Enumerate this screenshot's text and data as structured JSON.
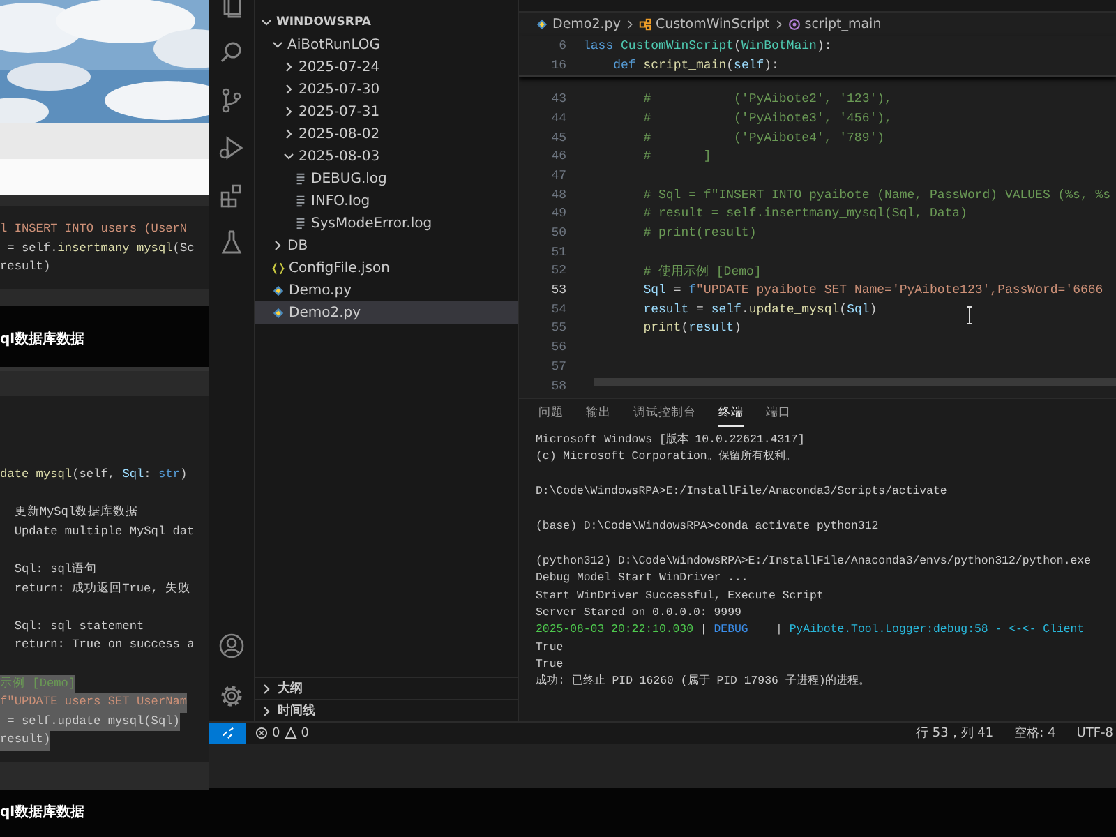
{
  "document": {
    "blocks": [
      {
        "kind": "picture"
      },
      {
        "kind": "bar"
      },
      {
        "kind": "code",
        "groups": [
          {
            "lines": [
              {
                "tokens": [
                  {
                    "text": "l INSERT INTO users (UserN",
                    "kind": "string"
                  }
                ]
              },
              {
                "tokens": [
                  {
                    "text": " = self.",
                    "kind": "plain"
                  },
                  {
                    "text": "insertmany_mysql",
                    "kind": "function"
                  },
                  {
                    "text": "(Sc",
                    "kind": "plain"
                  }
                ]
              },
              {
                "tokens": [
                  {
                    "text": "result)",
                    "kind": "plain"
                  }
                ]
              }
            ]
          }
        ]
      },
      {
        "kind": "heading",
        "text": "ql数据库数据"
      },
      {
        "kind": "code",
        "groups": [
          {
            "lines": [
              {
                "selected": false,
                "tokens": [
                  {
                    "text": "date_mysql",
                    "kind": "function"
                  },
                  {
                    "text": "(self, ",
                    "kind": "plain"
                  },
                  {
                    "text": "Sql",
                    "kind": "variable"
                  },
                  {
                    "text": ": ",
                    "kind": "plain"
                  },
                  {
                    "text": "str",
                    "kind": "keyword"
                  },
                  {
                    "text": ")",
                    "kind": "plain"
                  }
                ]
              }
            ]
          },
          {
            "lines": [
              {
                "selected": false,
                "tokens": [
                  {
                    "text": "  更新MySql数据库数据",
                    "kind": "plain"
                  }
                ]
              },
              {
                "selected": false,
                "tokens": [
                  {
                    "text": "  Update multiple MySql dat",
                    "kind": "plain"
                  }
                ]
              }
            ]
          },
          {
            "lines": [
              {
                "selected": false,
                "tokens": [
                  {
                    "text": "  Sql: sql语句",
                    "kind": "plain"
                  }
                ]
              },
              {
                "selected": false,
                "tokens": [
                  {
                    "text": "  return: 成功返回True, 失败",
                    "kind": "plain"
                  }
                ]
              }
            ]
          },
          {
            "lines": [
              {
                "selected": false,
                "tokens": [
                  {
                    "text": "  Sql: sql statement",
                    "kind": "plain"
                  }
                ]
              },
              {
                "selected": false,
                "tokens": [
                  {
                    "text": "  return: True on success a",
                    "kind": "plain"
                  }
                ]
              }
            ]
          },
          {
            "lines": [
              {
                "selected": true,
                "tokens": [
                  {
                    "text": "示例 [Demo]",
                    "kind": "comment"
                  }
                ]
              },
              {
                "selected": true,
                "tokens": [
                  {
                    "text": "f\"UPDATE users SET UserNam",
                    "kind": "string"
                  }
                ]
              },
              {
                "selected": true,
                "tokens": [
                  {
                    "text": " = self.update_mysql(Sql)",
                    "kind": "plain"
                  }
                ]
              },
              {
                "selected": true,
                "tokens": [
                  {
                    "text": "result)",
                    "kind": "plain"
                  }
                ]
              }
            ]
          }
        ]
      },
      {
        "kind": "heading",
        "text": "ql数据库数据"
      }
    ]
  },
  "explorer": {
    "tree": [
      {
        "label": "WINDOWSRPA",
        "kind": "root",
        "expanded": true,
        "selected": false,
        "children": [
          {
            "label": "AiBotRunLOG",
            "kind": "folder",
            "expanded": true,
            "selected": false,
            "children": [
              {
                "label": "2025-07-24",
                "kind": "folder",
                "expanded": false,
                "selected": false
              },
              {
                "label": "2025-07-30",
                "kind": "folder",
                "expanded": false,
                "selected": false
              },
              {
                "label": "2025-07-31",
                "kind": "folder",
                "expanded": false,
                "selected": false
              },
              {
                "label": "2025-08-02",
                "kind": "folder",
                "expanded": false,
                "selected": false
              },
              {
                "label": "2025-08-03",
                "kind": "folder",
                "expanded": true,
                "selected": false,
                "children": [
                  {
                    "label": "DEBUG.log",
                    "kind": "log",
                    "selected": false
                  },
                  {
                    "label": "INFO.log",
                    "kind": "log",
                    "selected": false
                  },
                  {
                    "label": "SysModeError.log",
                    "kind": "log",
                    "selected": false
                  }
                ]
              }
            ]
          },
          {
            "label": "DB",
            "kind": "folder",
            "expanded": false,
            "selected": false
          },
          {
            "label": "ConfigFile.json",
            "kind": "json",
            "selected": false
          },
          {
            "label": "Demo.py",
            "kind": "python",
            "selected": false
          },
          {
            "label": "Demo2.py",
            "kind": "python",
            "selected": true
          }
        ]
      }
    ],
    "sections": [
      {
        "label": "大纲",
        "expanded": false
      },
      {
        "label": "时间线",
        "expanded": false
      }
    ]
  },
  "editor": {
    "breadcrumbs": [
      {
        "label": "Demo2.py",
        "kind": "python"
      },
      {
        "label": "CustomWinScript",
        "kind": "class"
      },
      {
        "label": "script_main",
        "kind": "method"
      }
    ],
    "sticky_lines": [
      {
        "number": "6",
        "tokens": [
          {
            "text": "lass ",
            "kind": "keyword"
          },
          {
            "text": "CustomWinScript",
            "kind": "class"
          },
          {
            "text": "(",
            "kind": "plain"
          },
          {
            "text": "WinBotMain",
            "kind": "class"
          },
          {
            "text": "):",
            "kind": "plain"
          }
        ]
      },
      {
        "number": "16",
        "tokens": [
          {
            "text": "    def ",
            "kind": "keyword"
          },
          {
            "text": "script_main",
            "kind": "function"
          },
          {
            "text": "(",
            "kind": "plain"
          },
          {
            "text": "self",
            "kind": "variable"
          },
          {
            "text": "):",
            "kind": "plain"
          }
        ]
      }
    ],
    "lines": [
      {
        "number": "43",
        "current": false,
        "tokens": [
          {
            "text": "        #           ('PyAibote2', '123'),",
            "kind": "comment"
          }
        ]
      },
      {
        "number": "44",
        "current": false,
        "tokens": [
          {
            "text": "        #           ('PyAibote3', '456'),",
            "kind": "comment"
          }
        ]
      },
      {
        "number": "45",
        "current": false,
        "tokens": [
          {
            "text": "        #           ('PyAibote4', '789')",
            "kind": "comment"
          }
        ]
      },
      {
        "number": "46",
        "current": false,
        "tokens": [
          {
            "text": "        #       ]",
            "kind": "comment"
          }
        ]
      },
      {
        "number": "47",
        "current": false
      },
      {
        "number": "48",
        "current": false,
        "tokens": [
          {
            "text": "        # Sql = f\"INSERT INTO pyaibote (Name, PassWord) VALUES (%s, %s",
            "kind": "comment"
          }
        ]
      },
      {
        "number": "49",
        "current": false,
        "tokens": [
          {
            "text": "        # result = self.insertmany_mysql(Sql, Data)",
            "kind": "comment"
          }
        ]
      },
      {
        "number": "50",
        "current": false,
        "tokens": [
          {
            "text": "        # print(result)",
            "kind": "comment"
          }
        ]
      },
      {
        "number": "51",
        "current": false
      },
      {
        "number": "52",
        "current": false,
        "tokens": [
          {
            "text": "        # 使用示例 [Demo]",
            "kind": "comment"
          }
        ]
      },
      {
        "number": "53",
        "current": true,
        "tokens": [
          {
            "text": "        Sql",
            "kind": "variable"
          },
          {
            "text": " = ",
            "kind": "plain"
          },
          {
            "text": "f",
            "kind": "keyword"
          },
          {
            "text": "\"UPDATE pyaibote SET Name='PyAibote123',PassWord='6666",
            "kind": "string"
          }
        ]
      },
      {
        "number": "54",
        "current": false,
        "tokens": [
          {
            "text": "        result",
            "kind": "variable"
          },
          {
            "text": " = ",
            "kind": "plain"
          },
          {
            "text": "self",
            "kind": "variable"
          },
          {
            "text": ".",
            "kind": "plain"
          },
          {
            "text": "update_mysql",
            "kind": "function"
          },
          {
            "text": "(",
            "kind": "plain"
          },
          {
            "text": "Sql",
            "kind": "variable"
          },
          {
            "text": ")",
            "kind": "plain"
          }
        ]
      },
      {
        "number": "55",
        "current": false,
        "tokens": [
          {
            "text": "        print",
            "kind": "function"
          },
          {
            "text": "(",
            "kind": "plain"
          },
          {
            "text": "result",
            "kind": "variable"
          },
          {
            "text": ")",
            "kind": "plain"
          }
        ]
      },
      {
        "number": "56",
        "current": false
      },
      {
        "number": "57",
        "current": false
      },
      {
        "number": "58",
        "current": false
      }
    ]
  },
  "panel": {
    "tabs": [
      {
        "label": "问题",
        "selected": false
      },
      {
        "label": "输出",
        "selected": false
      },
      {
        "label": "调试控制台",
        "selected": false
      },
      {
        "label": "终端",
        "selected": true
      },
      {
        "label": "端口",
        "selected": false
      }
    ],
    "terminal": [
      {
        "lines": [
          {
            "segments": [
              {
                "text": "Microsoft Windows [版本 10.0.22621.4317]",
                "kind": "plain"
              }
            ]
          },
          {
            "segments": [
              {
                "text": "(c) Microsoft Corporation。保留所有权利。",
                "kind": "plain"
              }
            ]
          }
        ]
      },
      {
        "lines": [
          {
            "segments": [
              {
                "text": "D:\\Code\\WindowsRPA>E:/InstallFile/Anaconda3/Scripts/activate",
                "kind": "plain"
              }
            ]
          }
        ]
      },
      {
        "lines": [
          {
            "segments": [
              {
                "text": "(base) D:\\Code\\WindowsRPA>conda activate python312",
                "kind": "plain"
              }
            ]
          }
        ]
      },
      {
        "lines": [
          {
            "segments": [
              {
                "text": "(python312) D:\\Code\\WindowsRPA>E:/InstallFile/Anaconda3/envs/python312/python.exe",
                "kind": "plain"
              }
            ]
          },
          {
            "segments": [
              {
                "text": "Debug Model Start WinDriver ...",
                "kind": "plain"
              }
            ]
          },
          {
            "segments": [
              {
                "text": "Start WinDriver Successful, Execute Script",
                "kind": "plain"
              }
            ]
          },
          {
            "segments": [
              {
                "text": "Server Stared on 0.0.0.0: 9999",
                "kind": "plain"
              }
            ]
          },
          {
            "segments": [
              {
                "text": "2025-08-03 20:22:10.030",
                "kind": "green"
              },
              {
                "text": " | ",
                "kind": "plain"
              },
              {
                "text": "DEBUG",
                "kind": "blue"
              },
              {
                "text": "    | ",
                "kind": "plain"
              },
              {
                "text": "PyAibote.Tool.Logger",
                "kind": "cyan"
              },
              {
                "text": ":debug:58 - ",
                "kind": "cyan"
              },
              {
                "text": "<-<- Client",
                "kind": "cyan"
              }
            ]
          },
          {
            "segments": [
              {
                "text": "True",
                "kind": "plain"
              }
            ]
          },
          {
            "segments": [
              {
                "text": "True",
                "kind": "plain"
              }
            ]
          },
          {
            "segments": [
              {
                "text": "成功: 已终止 PID 16260 (属于 PID 17936 子进程)的进程。",
                "kind": "plain"
              }
            ]
          }
        ]
      }
    ]
  },
  "status_bar": {
    "errors": "0",
    "warnings": "0",
    "items": [
      "行 53，列 41",
      "空格: 4",
      "UTF-8"
    ]
  }
}
